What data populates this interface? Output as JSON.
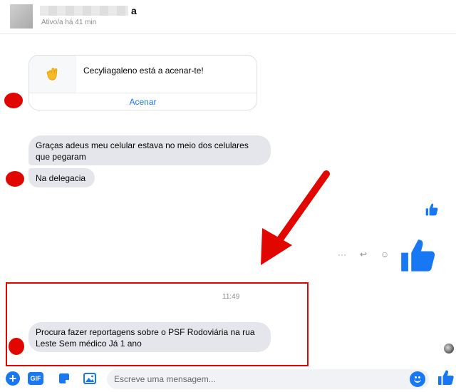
{
  "header": {
    "name": "a",
    "status": "Ativo/a há 41 min"
  },
  "wave": {
    "text": "Cecyliagaleno está a acenar-te!",
    "action": "Acenar",
    "icon": "waving-hand-icon"
  },
  "messages": [
    {
      "text": "Graças  adeus meu celular  estava no meio dos celulares que pegaram"
    },
    {
      "text": "Na delegacia"
    },
    {
      "text": "Procura fazer reportagens sobre o PSF  Rodoviária  na rua Leste  Sem médico   Já 1 ano"
    }
  ],
  "timestamp": "11:49",
  "message_actions": {
    "more": "···",
    "reply": "↩",
    "react": "☺"
  },
  "composer": {
    "plus": "+",
    "gif": "GIF",
    "placeholder": "Escreve uma mensagem..."
  },
  "colors": {
    "accent": "#1877f2",
    "bubble": "#e4e6eb",
    "annotation": "#e10600"
  }
}
